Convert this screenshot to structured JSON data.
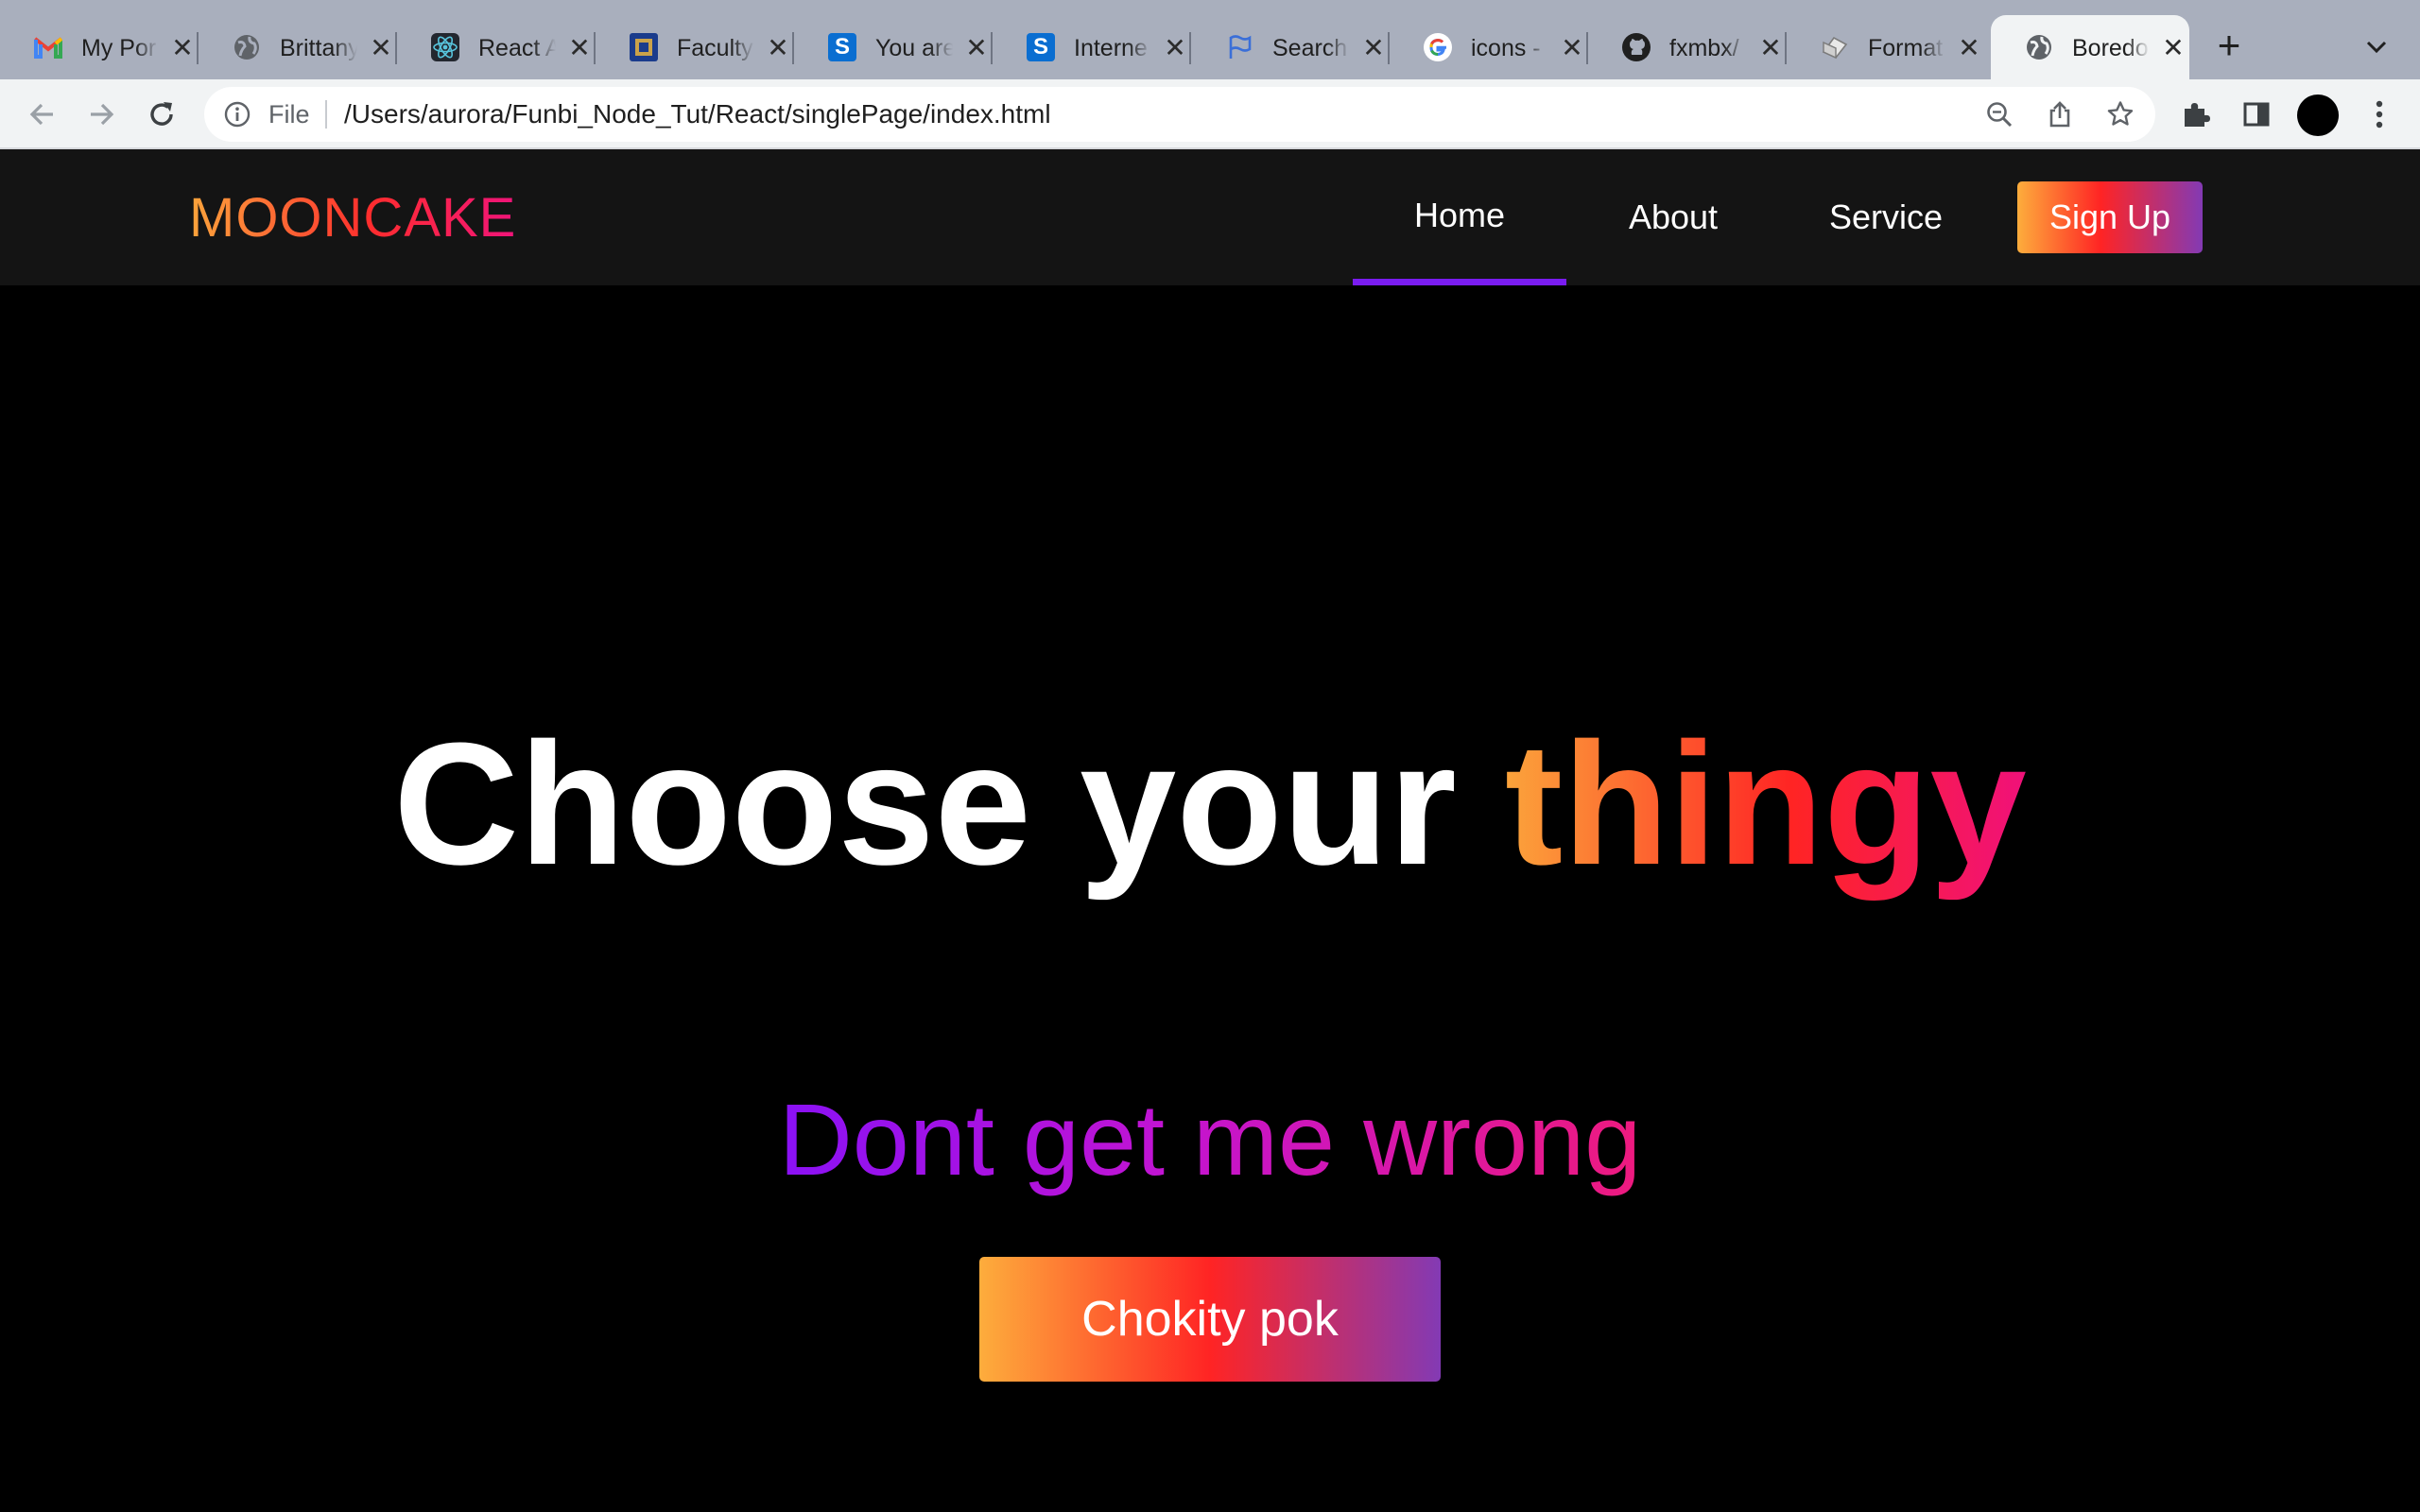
{
  "browser": {
    "tabs": [
      {
        "title": "My Por",
        "icon": "gmail-icon",
        "active": false
      },
      {
        "title": "Brittany",
        "icon": "globe-icon",
        "active": false
      },
      {
        "title": "React A",
        "icon": "react-icon",
        "active": false
      },
      {
        "title": "Faculty",
        "icon": "faculty-icon",
        "active": false
      },
      {
        "title": "You are",
        "icon": "s-logo-icon",
        "active": false
      },
      {
        "title": "Interne",
        "icon": "s-logo-icon",
        "active": false
      },
      {
        "title": "Search",
        "icon": "flag-icon",
        "active": false
      },
      {
        "title": "icons -",
        "icon": "google-icon",
        "active": false
      },
      {
        "title": "fxmbx/",
        "icon": "github-icon",
        "active": false
      },
      {
        "title": "Format",
        "icon": "format-icon",
        "active": false
      },
      {
        "title": "Boredo",
        "icon": "globe-icon",
        "active": true
      }
    ],
    "close_glyph": "✕",
    "new_tab_glyph": "+",
    "address": {
      "scheme_label": "File",
      "url": "/Users/aurora/Funbi_Node_Tut/React/singlePage/index.html"
    }
  },
  "site": {
    "logo": "MOONCAKE",
    "nav": {
      "home": "Home",
      "about": "About",
      "service": "Service"
    },
    "signup_label": "Sign Up",
    "hero": {
      "title_plain": "Choose your ",
      "title_highlight": "thingy",
      "subtitle": "Dont get me wrong",
      "cta_label": "Chokity pok"
    }
  },
  "colors": {
    "nav_bg": "#141414",
    "page_bg": "#000000",
    "active_underline": "#7a1cf0",
    "gradient_warm": [
      "#fdad3c",
      "#ff2424",
      "#833ab4"
    ],
    "gradient_sub": [
      "#8a11f5",
      "#c214d2",
      "#ee1a7e"
    ]
  }
}
